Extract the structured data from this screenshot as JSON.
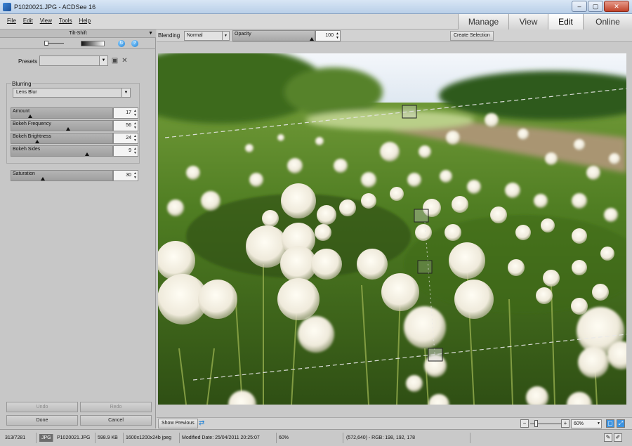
{
  "window": {
    "title": "P1020021.JPG - ACDSee 16",
    "minimize": "–",
    "maximize": "▢",
    "close": "✕"
  },
  "menu": [
    "File",
    "Edit",
    "View",
    "Tools",
    "Help"
  ],
  "modes": [
    {
      "label": "Manage",
      "active": false
    },
    {
      "label": "View",
      "active": false
    },
    {
      "label": "Edit",
      "active": true
    },
    {
      "label": "Online",
      "active": false
    }
  ],
  "panel": {
    "title": "Tilt-Shift",
    "arrow": "▼",
    "presets_label": "Presets",
    "presets_value": "",
    "group_label": "Blurring",
    "blur_type": "Lens Blur",
    "sliders": [
      {
        "label": "Amount",
        "value": "17",
        "fraction": 0.17
      },
      {
        "label": "Bokeh Frequency",
        "value": "56",
        "fraction": 0.56
      },
      {
        "label": "Bokeh Brightness",
        "value": "24",
        "fraction": 0.24
      },
      {
        "label": "Bokeh Sides",
        "value": "9",
        "fraction": 0.75
      }
    ],
    "saturation": {
      "label": "Saturation",
      "value": "30",
      "fraction": 0.3
    },
    "undo": "Undo",
    "redo": "Redo",
    "done": "Done",
    "cancel": "Cancel"
  },
  "options": {
    "blending_label": "Blending",
    "blending_value": "Normal",
    "opacity_label": "Opacity",
    "opacity_value": "100",
    "opacity_fraction": 1.0,
    "create_selection": "Create Selection"
  },
  "bottom": {
    "show_previous": "Show Previous",
    "zoom": "60%"
  },
  "status": {
    "index": "313/7281",
    "format": "JPG",
    "filename": "P1020021.JPG",
    "size": "598.9 KB",
    "dimensions": "1600x1200x24b jpeg",
    "modified": "Modified Date: 25/04/2011 20:25:07",
    "zoom": "60%",
    "pixel": "(572,640) - RGB: 198, 192, 178"
  },
  "colors": {
    "accent": "#1a7fd6",
    "sky": "#eef3f8",
    "grass": "#4f7a22",
    "flower": "#f2f0e6"
  }
}
